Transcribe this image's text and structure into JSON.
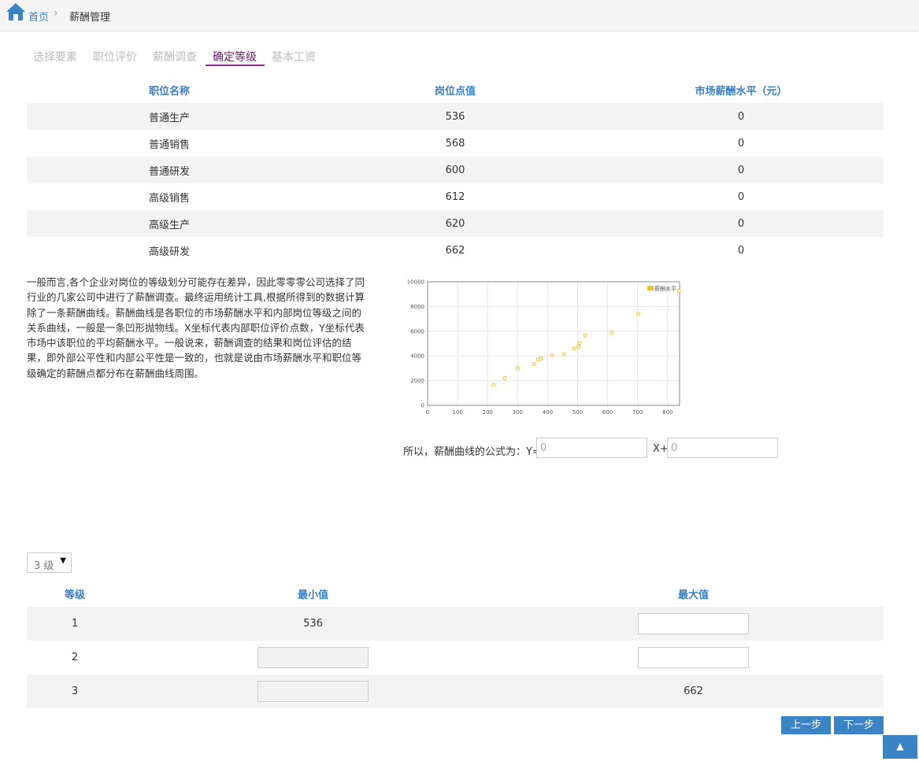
{
  "breadcrumb": {
    "home": "首页",
    "separator": "›",
    "current": "薪酬管理"
  },
  "tabs": [
    {
      "label": "选择要素",
      "active": false
    },
    {
      "label": "职位评价",
      "active": false
    },
    {
      "label": "薪酬调查",
      "active": false
    },
    {
      "label": "确定等级",
      "active": true
    },
    {
      "label": "基本工资",
      "active": false
    }
  ],
  "job_table": {
    "headers": [
      "职位名称",
      "岗位点值",
      "市场薪酬水平（元）"
    ],
    "rows": [
      [
        "普通生产",
        "536",
        "0"
      ],
      [
        "普通销售",
        "568",
        "0"
      ],
      [
        "普通研发",
        "600",
        "0"
      ],
      [
        "高级销售",
        "612",
        "0"
      ],
      [
        "高级生产",
        "620",
        "0"
      ],
      [
        "高级研发",
        "662",
        "0"
      ]
    ]
  },
  "description": "一般而言,各个企业对岗位的等级划分可能存在差异，因此零零零公司选择了同行业的几家公司中进行了薪酬调查。最终运用统计工具,根据所得到的数据计算除了一条薪酬曲线。薪酬曲线是各职位的市场薪酬水平和内部岗位等级之间的关系曲线，一般是一条凹形抛物线。X坐标代表内部职位评价点数，Y坐标代表市场中该职位的平均薪酬水平。一般说来，薪酬调查的结果和岗位评估的结果，即外部公平性和内部公平性是一致的，也就是说由市场薪酬水平和职位等级确定的薪酬点都分布在薪酬曲线周围。",
  "chart_data": {
    "type": "scatter",
    "series": [
      {
        "name": "薪酬水平",
        "x": [
          220,
          257,
          300,
          355,
          368,
          378,
          415,
          455,
          488,
          503,
          507,
          525,
          614,
          702,
          838
        ],
        "y": [
          1650,
          2200,
          3000,
          3350,
          3700,
          3800,
          4050,
          4150,
          4600,
          4750,
          5050,
          5650,
          5850,
          7400,
          9250
        ]
      }
    ],
    "xlim": [
      0,
      840
    ],
    "ylim": [
      0,
      10000
    ],
    "xticks": [
      "0",
      "100",
      "200",
      "300",
      "400",
      "500",
      "600",
      "700",
      "800"
    ],
    "yticks": [
      "0",
      "2000",
      "4000",
      "6000",
      "8000",
      "10000"
    ],
    "grid": true,
    "legend": "top-right",
    "color": "#f0c030"
  },
  "formula": {
    "label": "所以，薪酬曲线的公式为：Y=",
    "coef_value": "0",
    "x_label": "X+",
    "const_value": "0"
  },
  "level_select": {
    "value": "3 级",
    "arrow": "▼"
  },
  "grade_table": {
    "headers": [
      "等级",
      "最小值",
      "最大值"
    ],
    "rows": [
      {
        "level": "1",
        "min": "536",
        "max": ""
      },
      {
        "level": "2",
        "min": "",
        "max": ""
      },
      {
        "level": "3",
        "min": "",
        "max": "662"
      }
    ]
  },
  "buttons": {
    "prev": "上一步",
    "next": "下一步",
    "top": "▲"
  },
  "colors": {
    "accent": "#3a83c4",
    "header_text": "#3a7fc1",
    "active_tab": "#6a1b6a"
  }
}
